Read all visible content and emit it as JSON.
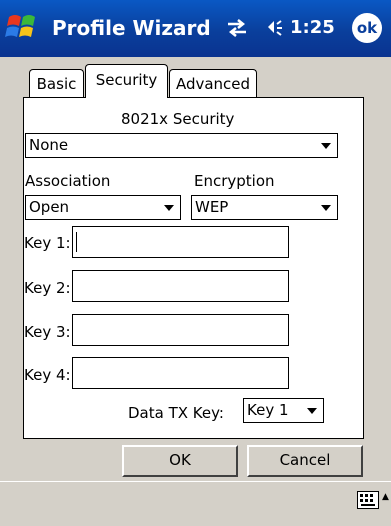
{
  "titlebar": {
    "title": "Profile Wizard",
    "time": "1:25",
    "ok_label": "ok"
  },
  "tabs": [
    {
      "label": "Basic",
      "selected": false
    },
    {
      "label": "Security",
      "selected": true
    },
    {
      "label": "Advanced",
      "selected": false
    }
  ],
  "security": {
    "label_8021x": "8021x Security",
    "value_8021x": "None",
    "association_label": "Association",
    "association_value": "Open",
    "encryption_label": "Encryption",
    "encryption_value": "WEP"
  },
  "keys": [
    {
      "label": "Key 1:",
      "value": ""
    },
    {
      "label": "Key 2:",
      "value": ""
    },
    {
      "label": "Key 3:",
      "value": ""
    },
    {
      "label": "Key 4:",
      "value": ""
    }
  ],
  "data_tx": {
    "label": "Data TX Key:",
    "value": "Key 1"
  },
  "buttons": {
    "ok": "OK",
    "cancel": "Cancel"
  },
  "colors": {
    "titlebar": "#0a3f9c",
    "dialog_bg": "#d4d0c8"
  },
  "icons": [
    "windows-flag-icon",
    "connectivity-icon",
    "volume-icon",
    "ok-icon",
    "keyboard-icon",
    "sip-arrow-up-icon",
    "dropdown-arrow-icon"
  ]
}
